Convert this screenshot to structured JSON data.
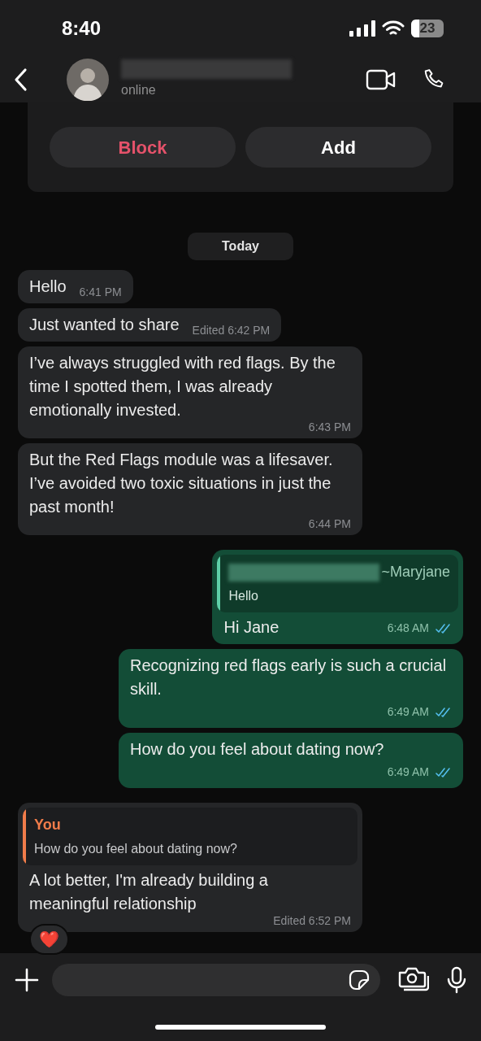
{
  "status_bar": {
    "time": "8:40",
    "battery": "23"
  },
  "header": {
    "status": "online"
  },
  "contact_card": {
    "buttons": [
      {
        "label": "Block",
        "kind": "danger"
      },
      {
        "label": "Add",
        "kind": "normal"
      }
    ]
  },
  "date_chip": "Today",
  "messages": [
    {
      "kind": "incoming",
      "text": "Hello",
      "meta": "6:41 PM"
    },
    {
      "kind": "incoming",
      "text": "Just wanted to share",
      "meta": "Edited 6:42 PM"
    },
    {
      "kind": "incoming",
      "text": "I’ve always struggled with red flags. By the time I spotted them, I was already emotionally invested.",
      "meta": "6:43 PM"
    },
    {
      "kind": "incoming",
      "text": "But the Red Flags module was a lifesaver. I’ve avoided two toxic situations in just the past month!",
      "meta": "6:44 PM"
    },
    {
      "kind": "outgoing",
      "quote": {
        "author": "~Maryjane",
        "text": "Hello",
        "color": "#5fcfa8",
        "redacted": true
      },
      "text": "Hi Jane",
      "meta": "6:48 AM",
      "read": true
    },
    {
      "kind": "outgoing",
      "text": "Recognizing red flags early is such a crucial skill.",
      "meta": "6:49 AM",
      "read": true
    },
    {
      "kind": "outgoing",
      "text": "How do you feel about dating now?",
      "meta": "6:49 AM",
      "read": true
    },
    {
      "kind": "incoming",
      "quote": {
        "author": "You",
        "text": "How do you feel about dating now?",
        "color": "#f07c4a",
        "redacted": false
      },
      "text": "A lot better, I'm already building a meaningful relationship",
      "meta": "Edited 6:52 PM",
      "reaction": "❤️"
    }
  ]
}
